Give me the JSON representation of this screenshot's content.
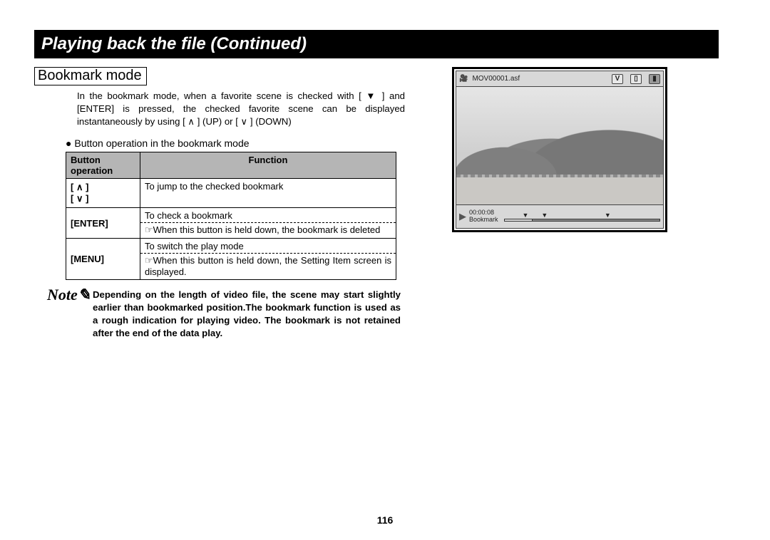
{
  "title": "Playing back the file (Continued)",
  "subsection": "Bookmark mode",
  "intro": "In the bookmark mode, when a favorite scene is checked with [ ▼ ] and [ENTER] is pressed, the checked favorite scene can be displayed instantaneously by using [ ∧ ] (UP) or [ ∨ ] (DOWN)",
  "bullet": "Button operation in the bookmark mode",
  "table": {
    "head1": "Button operation",
    "head2": "Function",
    "rows": [
      {
        "btn1": "[ ∧ ]",
        "btn2": "[ ∨ ]",
        "fn": "To jump to the checked bookmark"
      },
      {
        "btn": "[ENTER]",
        "l1": "To check a bookmark",
        "l2": "☞When this button is held down, the bookmark is deleted"
      },
      {
        "btn": "[MENU]",
        "l1": "To switch the play mode",
        "l2": "☞When this button is held down, the Setting Item screen is displayed."
      }
    ]
  },
  "note_label": "Note",
  "note": "Depending on the length of video file, the scene may start slightly earlier than bookmarked position.The bookmark function is used as a rough indication for playing video. The bookmark is not retained after the end of the data play.",
  "page_number": "116",
  "preview": {
    "filename": "MOV00001.asf",
    "timecode": "00:00:08",
    "mode_label": "Bookmark",
    "badge_letter": "V"
  }
}
